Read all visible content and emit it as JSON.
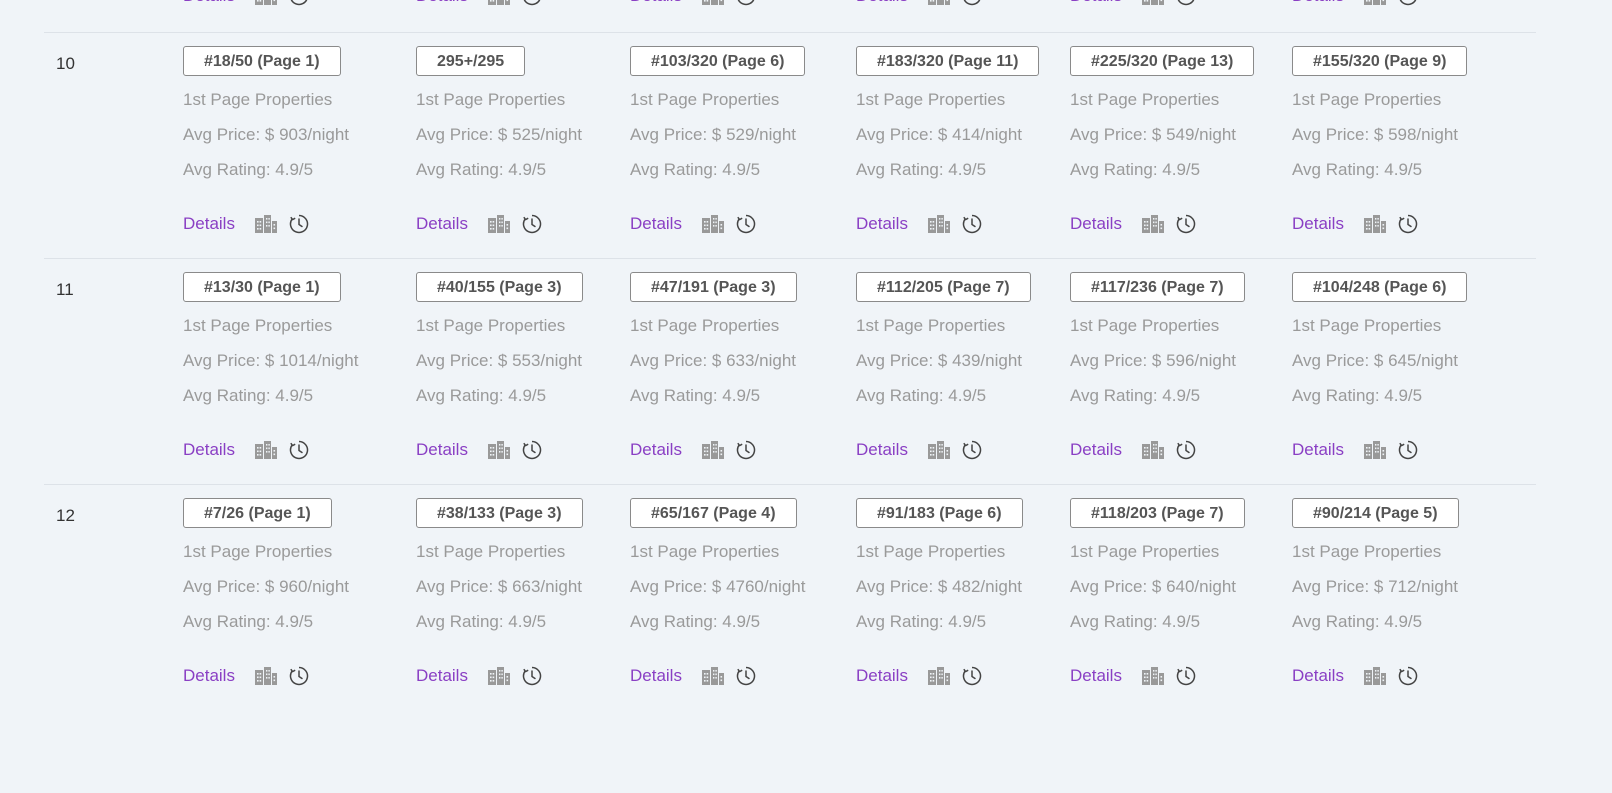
{
  "top_row": {
    "cells": [
      {
        "details_label": "Details"
      },
      {
        "details_label": "Details"
      },
      {
        "details_label": "Details"
      },
      {
        "details_label": "Details"
      },
      {
        "details_label": "Details"
      },
      {
        "details_label": "Details"
      }
    ]
  },
  "rows": [
    {
      "label": "10",
      "cells": [
        {
          "rank": "#18/50 (Page 1)",
          "first_page": "1st Page Properties",
          "avg_price": "Avg Price: $ 903/night",
          "avg_rating": "Avg Rating: 4.9/5",
          "details_label": "Details"
        },
        {
          "rank": "295+/295",
          "first_page": "1st Page Properties",
          "avg_price": "Avg Price: $ 525/night",
          "avg_rating": "Avg Rating: 4.9/5",
          "details_label": "Details"
        },
        {
          "rank": "#103/320 (Page 6)",
          "first_page": "1st Page Properties",
          "avg_price": "Avg Price: $ 529/night",
          "avg_rating": "Avg Rating: 4.9/5",
          "details_label": "Details"
        },
        {
          "rank": "#183/320 (Page 11)",
          "first_page": "1st Page Properties",
          "avg_price": "Avg Price: $ 414/night",
          "avg_rating": "Avg Rating: 4.9/5",
          "details_label": "Details"
        },
        {
          "rank": "#225/320 (Page 13)",
          "first_page": "1st Page Properties",
          "avg_price": "Avg Price: $ 549/night",
          "avg_rating": "Avg Rating: 4.9/5",
          "details_label": "Details"
        },
        {
          "rank": "#155/320 (Page 9)",
          "first_page": "1st Page Properties",
          "avg_price": "Avg Price: $ 598/night",
          "avg_rating": "Avg Rating: 4.9/5",
          "details_label": "Details"
        }
      ]
    },
    {
      "label": "11",
      "cells": [
        {
          "rank": "#13/30 (Page 1)",
          "first_page": "1st Page Properties",
          "avg_price": "Avg Price: $ 1014/night",
          "avg_rating": "Avg Rating: 4.9/5",
          "details_label": "Details"
        },
        {
          "rank": "#40/155 (Page 3)",
          "first_page": "1st Page Properties",
          "avg_price": "Avg Price: $ 553/night",
          "avg_rating": "Avg Rating: 4.9/5",
          "details_label": "Details"
        },
        {
          "rank": "#47/191 (Page 3)",
          "first_page": "1st Page Properties",
          "avg_price": "Avg Price: $ 633/night",
          "avg_rating": "Avg Rating: 4.9/5",
          "details_label": "Details"
        },
        {
          "rank": "#112/205 (Page 7)",
          "first_page": "1st Page Properties",
          "avg_price": "Avg Price: $ 439/night",
          "avg_rating": "Avg Rating: 4.9/5",
          "details_label": "Details"
        },
        {
          "rank": "#117/236 (Page 7)",
          "first_page": "1st Page Properties",
          "avg_price": "Avg Price: $ 596/night",
          "avg_rating": "Avg Rating: 4.9/5",
          "details_label": "Details"
        },
        {
          "rank": "#104/248 (Page 6)",
          "first_page": "1st Page Properties",
          "avg_price": "Avg Price: $ 645/night",
          "avg_rating": "Avg Rating: 4.9/5",
          "details_label": "Details"
        }
      ]
    },
    {
      "label": "12",
      "cells": [
        {
          "rank": "#7/26 (Page 1)",
          "first_page": "1st Page Properties",
          "avg_price": "Avg Price: $ 960/night",
          "avg_rating": "Avg Rating: 4.9/5",
          "details_label": "Details"
        },
        {
          "rank": "#38/133 (Page 3)",
          "first_page": "1st Page Properties",
          "avg_price": "Avg Price: $ 663/night",
          "avg_rating": "Avg Rating: 4.9/5",
          "details_label": "Details"
        },
        {
          "rank": "#65/167 (Page 4)",
          "first_page": "1st Page Properties",
          "avg_price": "Avg Price: $ 4760/night",
          "avg_rating": "Avg Rating: 4.9/5",
          "details_label": "Details"
        },
        {
          "rank": "#91/183 (Page 6)",
          "first_page": "1st Page Properties",
          "avg_price": "Avg Price: $ 482/night",
          "avg_rating": "Avg Rating: 4.9/5",
          "details_label": "Details"
        },
        {
          "rank": "#118/203 (Page 7)",
          "first_page": "1st Page Properties",
          "avg_price": "Avg Price: $ 640/night",
          "avg_rating": "Avg Rating: 4.9/5",
          "details_label": "Details"
        },
        {
          "rank": "#90/214 (Page 5)",
          "first_page": "1st Page Properties",
          "avg_price": "Avg Price: $ 712/night",
          "avg_rating": "Avg Rating: 4.9/5",
          "details_label": "Details"
        }
      ]
    }
  ],
  "icons": {
    "building": "building-icon",
    "history": "history-clock-icon"
  },
  "colors": {
    "background": "#f0f4f8",
    "link": "#8a3fc4",
    "muted_text": "#9a9a9a",
    "badge_border": "#8a8a8a",
    "icon": "#999999"
  }
}
